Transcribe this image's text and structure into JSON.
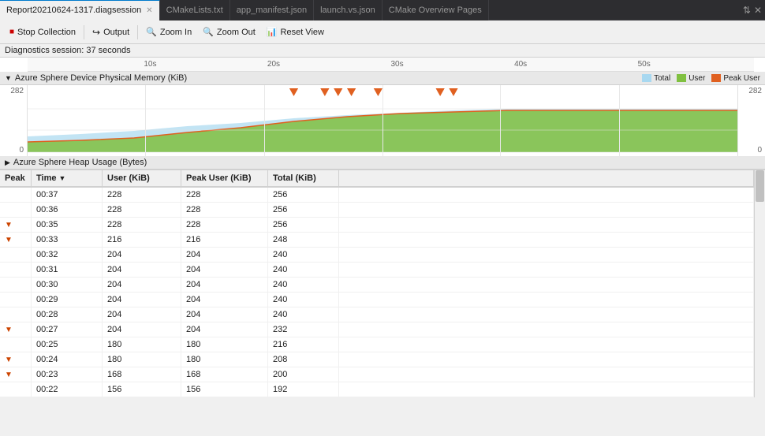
{
  "tabs": [
    {
      "id": "diag",
      "label": "Report20210624-1317.diagsession",
      "active": true,
      "closeable": true
    },
    {
      "id": "cmake",
      "label": "CMakeLists.txt",
      "active": false,
      "closeable": false
    },
    {
      "id": "manifest",
      "label": "app_manifest.json",
      "active": false,
      "closeable": false
    },
    {
      "id": "launch",
      "label": "launch.vs.json",
      "active": false,
      "closeable": false
    },
    {
      "id": "cmakeoverview",
      "label": "CMake Overview Pages",
      "active": false,
      "closeable": false
    }
  ],
  "toolbar": {
    "stop_label": "Stop Collection",
    "output_label": "Output",
    "zoom_in_label": "Zoom In",
    "zoom_out_label": "Zoom Out",
    "reset_view_label": "Reset View"
  },
  "status": {
    "label": "Diagnostics session: 37 seconds"
  },
  "chart": {
    "title": "Azure Sphere Device Physical Memory (KiB)",
    "y_max": "282",
    "y_min": "0",
    "legend": [
      {
        "label": "Total",
        "color": "#a8d8f0"
      },
      {
        "label": "User",
        "color": "#80c040"
      },
      {
        "label": "Peak User",
        "color": "#e06020"
      }
    ],
    "timeline": {
      "ticks": [
        "10s",
        "20s",
        "30s",
        "40s",
        "50s"
      ]
    }
  },
  "heap": {
    "title": "Azure Sphere Heap Usage (Bytes)"
  },
  "table": {
    "columns": [
      {
        "id": "peak",
        "label": "Peak"
      },
      {
        "id": "time",
        "label": "Time",
        "sort": "desc"
      },
      {
        "id": "user",
        "label": "User (KiB)"
      },
      {
        "id": "peakuser",
        "label": "Peak User (KiB)"
      },
      {
        "id": "total",
        "label": "Total (KiB)"
      }
    ],
    "rows": [
      {
        "peak": false,
        "time": "00:37",
        "user": "228",
        "peakuser": "228",
        "total": "256"
      },
      {
        "peak": false,
        "time": "00:36",
        "user": "228",
        "peakuser": "228",
        "total": "256"
      },
      {
        "peak": true,
        "time": "00:35",
        "user": "228",
        "peakuser": "228",
        "total": "256"
      },
      {
        "peak": true,
        "time": "00:33",
        "user": "216",
        "peakuser": "216",
        "total": "248"
      },
      {
        "peak": false,
        "time": "00:32",
        "user": "204",
        "peakuser": "204",
        "total": "240"
      },
      {
        "peak": false,
        "time": "00:31",
        "user": "204",
        "peakuser": "204",
        "total": "240"
      },
      {
        "peak": false,
        "time": "00:30",
        "user": "204",
        "peakuser": "204",
        "total": "240"
      },
      {
        "peak": false,
        "time": "00:29",
        "user": "204",
        "peakuser": "204",
        "total": "240"
      },
      {
        "peak": false,
        "time": "00:28",
        "user": "204",
        "peakuser": "204",
        "total": "240"
      },
      {
        "peak": true,
        "time": "00:27",
        "user": "204",
        "peakuser": "204",
        "total": "232"
      },
      {
        "peak": false,
        "time": "00:25",
        "user": "180",
        "peakuser": "180",
        "total": "216"
      },
      {
        "peak": true,
        "time": "00:24",
        "user": "180",
        "peakuser": "180",
        "total": "208"
      },
      {
        "peak": true,
        "time": "00:23",
        "user": "168",
        "peakuser": "168",
        "total": "200"
      },
      {
        "peak": false,
        "time": "00:22",
        "user": "156",
        "peakuser": "156",
        "total": "192"
      }
    ]
  }
}
